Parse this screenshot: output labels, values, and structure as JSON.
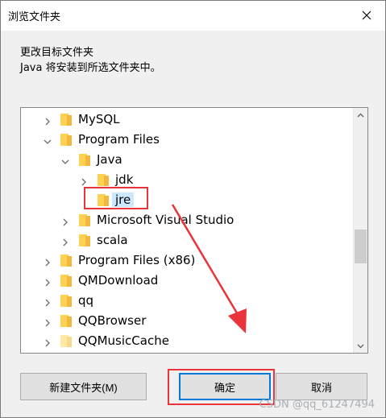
{
  "window": {
    "title": "浏览文件夹",
    "close_icon": "close-icon"
  },
  "message": {
    "line1": "更改目标文件夹",
    "line2": "Java 将安装到所选文件夹中。"
  },
  "tree": {
    "items": [
      {
        "label": "MySQL",
        "state": "collapsed",
        "selected": false
      },
      {
        "label": "Program Files",
        "state": "expanded",
        "selected": false
      },
      {
        "label": "Java",
        "state": "expanded",
        "selected": false
      },
      {
        "label": "jdk",
        "state": "collapsed",
        "selected": false
      },
      {
        "label": "jre",
        "state": "none",
        "selected": true
      },
      {
        "label": "Microsoft Visual Studio",
        "state": "collapsed",
        "selected": false
      },
      {
        "label": "scala",
        "state": "collapsed",
        "selected": false
      },
      {
        "label": "Program Files (x86)",
        "state": "collapsed",
        "selected": false
      },
      {
        "label": "QMDownload",
        "state": "collapsed",
        "selected": false
      },
      {
        "label": "qq",
        "state": "collapsed",
        "selected": false
      },
      {
        "label": "QQBrowser",
        "state": "collapsed",
        "selected": false
      },
      {
        "label": "QQMusicCache",
        "state": "collapsed",
        "selected": false
      }
    ]
  },
  "buttons": {
    "new_folder": "新建文件夹(M)",
    "ok": "确定",
    "cancel": "取消"
  },
  "watermark": "CSDN @qq_61247494",
  "colors": {
    "accent": "#0078d7",
    "selection": "#cce8ff",
    "annotation": "#e8343a",
    "folder": "#ffd152"
  }
}
